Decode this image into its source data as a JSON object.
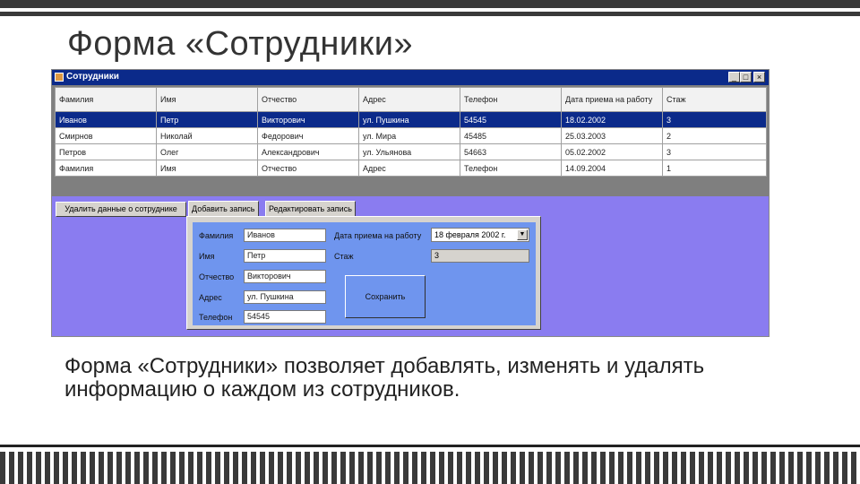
{
  "slide": {
    "title": "Форма «Сотрудники»",
    "caption": "Форма «Сотрудники» позволяет добавлять, изменять и удалять информацию о каждом из сотрудников."
  },
  "window": {
    "title": "Сотрудники",
    "controls": [
      "_",
      "□",
      "×"
    ]
  },
  "grid": {
    "columns": [
      "Фамилия",
      "Имя",
      "Отчество",
      "Адрес",
      "Телефон",
      "Дата приема на работу",
      "Стаж"
    ],
    "rows": [
      [
        "Иванов",
        "Петр",
        "Викторович",
        "ул. Пушкина",
        "54545",
        "18.02.2002",
        "3"
      ],
      [
        "Смирнов",
        "Николай",
        "Федорович",
        "ул. Мира",
        "45485",
        "25.03.2003",
        "2"
      ],
      [
        "Петров",
        "Олег",
        "Александрович",
        "ул. Ульянова",
        "54663",
        "05.02.2002",
        "3"
      ],
      [
        "Фамилия",
        "Имя",
        "Отчество",
        "Адрес",
        "Телефон",
        "14.09.2004",
        "1"
      ]
    ],
    "selected_row": 0
  },
  "delete_button": "Удалить данные о сотруднике",
  "tabs": [
    "Добавить запись",
    "Редактировать запись"
  ],
  "form": {
    "labels": {
      "lastname": "Фамилия",
      "firstname": "Имя",
      "patronymic": "Отчество",
      "address": "Адрес",
      "phone": "Телефон",
      "hire_date": "Дата приема на работу",
      "experience": "Стаж"
    },
    "values": {
      "lastname": "Иванов",
      "firstname": "Петр",
      "patronymic": "Викторович",
      "address": "ул. Пушкина",
      "phone": "54545",
      "hire_date": "18 февраля 2002 г.",
      "experience": "3"
    },
    "save_button": "Сохранить"
  },
  "colors": {
    "selection": "#0b2a8a",
    "window_bg": "#8a7cf0",
    "form_bg": "#6f95ee"
  }
}
